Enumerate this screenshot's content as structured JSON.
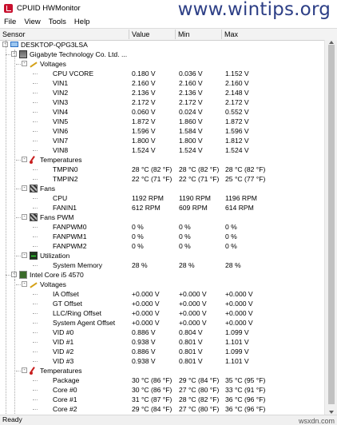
{
  "window": {
    "title": "CPUID HWMonitor",
    "watermark": "www.wintips.org",
    "site_mark": "wsxdn.com"
  },
  "menu": [
    "File",
    "View",
    "Tools",
    "Help"
  ],
  "columns": {
    "sensor": "Sensor",
    "value": "Value",
    "min": "Min",
    "max": "Max"
  },
  "rows": [
    {
      "level": 0,
      "icon": "pc-icon",
      "name": "DESKTOP-QPG3LSA",
      "expander": "-"
    },
    {
      "level": 1,
      "icon": "motherboard-icon",
      "name": "Gigabyte Technology Co. Ltd. ...",
      "expander": "-"
    },
    {
      "level": 2,
      "icon": "voltage-icon",
      "name": "Voltages",
      "expander": "-"
    },
    {
      "level": 3,
      "name": "CPU VCORE",
      "value": "0.180 V",
      "min": "0.036 V",
      "max": "1.152 V"
    },
    {
      "level": 3,
      "name": "VIN1",
      "value": "2.160 V",
      "min": "2.160 V",
      "max": "2.160 V"
    },
    {
      "level": 3,
      "name": "VIN2",
      "value": "2.136 V",
      "min": "2.136 V",
      "max": "2.148 V"
    },
    {
      "level": 3,
      "name": "VIN3",
      "value": "2.172 V",
      "min": "2.172 V",
      "max": "2.172 V"
    },
    {
      "level": 3,
      "name": "VIN4",
      "value": "0.060 V",
      "min": "0.024 V",
      "max": "0.552 V"
    },
    {
      "level": 3,
      "name": "VIN5",
      "value": "1.872 V",
      "min": "1.860 V",
      "max": "1.872 V"
    },
    {
      "level": 3,
      "name": "VIN6",
      "value": "1.596 V",
      "min": "1.584 V",
      "max": "1.596 V"
    },
    {
      "level": 3,
      "name": "VIN7",
      "value": "1.800 V",
      "min": "1.800 V",
      "max": "1.812 V"
    },
    {
      "level": 3,
      "name": "VIN8",
      "value": "1.524 V",
      "min": "1.524 V",
      "max": "1.524 V"
    },
    {
      "level": 2,
      "icon": "temperature-icon",
      "name": "Temperatures",
      "expander": "-"
    },
    {
      "level": 3,
      "name": "TMPIN0",
      "value": "28 °C  (82 °F)",
      "min": "28 °C  (82 °F)",
      "max": "28 °C  (82 °F)"
    },
    {
      "level": 3,
      "name": "TMPIN2",
      "value": "22 °C  (71 °F)",
      "min": "22 °C  (71 °F)",
      "max": "25 °C  (77 °F)"
    },
    {
      "level": 2,
      "icon": "fan-icon",
      "name": "Fans",
      "expander": "-"
    },
    {
      "level": 3,
      "name": "CPU",
      "value": "1192 RPM",
      "min": "1190 RPM",
      "max": "1196 RPM"
    },
    {
      "level": 3,
      "name": "FANIN1",
      "value": "612 RPM",
      "min": "609 RPM",
      "max": "614 RPM"
    },
    {
      "level": 2,
      "icon": "fan-pwm-icon",
      "name": "Fans PWM",
      "expander": "-"
    },
    {
      "level": 3,
      "name": "FANPWM0",
      "value": "0 %",
      "min": "0 %",
      "max": "0 %"
    },
    {
      "level": 3,
      "name": "FANPWM1",
      "value": "0 %",
      "min": "0 %",
      "max": "0 %"
    },
    {
      "level": 3,
      "name": "FANPWM2",
      "value": "0 %",
      "min": "0 %",
      "max": "0 %"
    },
    {
      "level": 2,
      "icon": "utilization-icon",
      "name": "Utilization",
      "expander": "-"
    },
    {
      "level": 3,
      "name": "System Memory",
      "value": "28 %",
      "min": "28 %",
      "max": "28 %"
    },
    {
      "level": 1,
      "icon": "cpu-icon",
      "name": "Intel Core i5 4570",
      "expander": "-"
    },
    {
      "level": 2,
      "icon": "voltage-icon",
      "name": "Voltages",
      "expander": "-"
    },
    {
      "level": 3,
      "name": "IA Offset",
      "value": "+0.000 V",
      "min": "+0.000 V",
      "max": "+0.000 V"
    },
    {
      "level": 3,
      "name": "GT Offset",
      "value": "+0.000 V",
      "min": "+0.000 V",
      "max": "+0.000 V"
    },
    {
      "level": 3,
      "name": "LLC/Ring Offset",
      "value": "+0.000 V",
      "min": "+0.000 V",
      "max": "+0.000 V"
    },
    {
      "level": 3,
      "name": "System Agent Offset",
      "value": "+0.000 V",
      "min": "+0.000 V",
      "max": "+0.000 V"
    },
    {
      "level": 3,
      "name": "VID #0",
      "value": "0.886 V",
      "min": "0.804 V",
      "max": "1.099 V"
    },
    {
      "level": 3,
      "name": "VID #1",
      "value": "0.938 V",
      "min": "0.801 V",
      "max": "1.101 V"
    },
    {
      "level": 3,
      "name": "VID #2",
      "value": "0.886 V",
      "min": "0.801 V",
      "max": "1.099 V"
    },
    {
      "level": 3,
      "name": "VID #3",
      "value": "0.938 V",
      "min": "0.801 V",
      "max": "1.101 V"
    },
    {
      "level": 2,
      "icon": "temperature-icon",
      "name": "Temperatures",
      "expander": "-"
    },
    {
      "level": 3,
      "name": "Package",
      "value": "30 °C  (86 °F)",
      "min": "29 °C  (84 °F)",
      "max": "35 °C  (95 °F)"
    },
    {
      "level": 3,
      "name": "Core #0",
      "value": "30 °C  (86 °F)",
      "min": "27 °C  (80 °F)",
      "max": "33 °C  (91 °F)"
    },
    {
      "level": 3,
      "name": "Core #1",
      "value": "31 °C  (87 °F)",
      "min": "28 °C  (82 °F)",
      "max": "36 °C  (96 °F)"
    },
    {
      "level": 3,
      "name": "Core #2",
      "value": "29 °C  (84 °F)",
      "min": "27 °C  (80 °F)",
      "max": "36 °C  (96 °F)"
    }
  ],
  "status": "Ready"
}
